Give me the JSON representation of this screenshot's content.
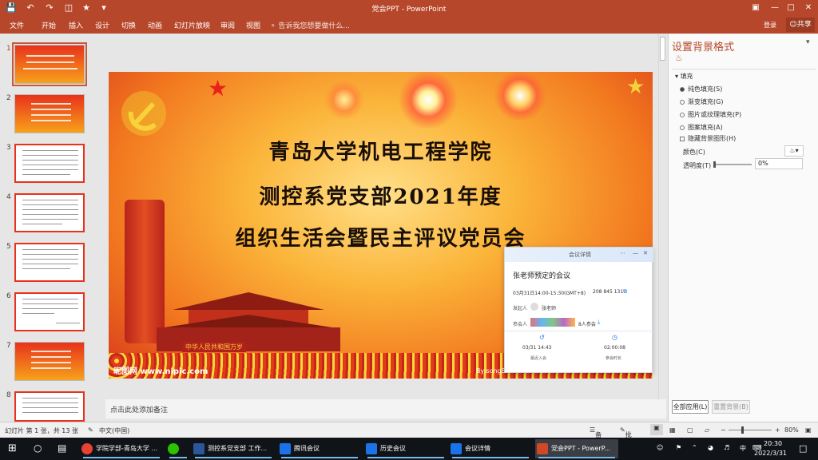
{
  "window": {
    "title": "党会PPT - PowerPoint",
    "quick_access": [
      "save-icon",
      "undo-icon",
      "redo-icon",
      "repeat-icon",
      "star-icon",
      "customize-icon"
    ]
  },
  "ribbon": {
    "tabs": [
      "文件",
      "开始",
      "插入",
      "设计",
      "切换",
      "动画",
      "幻灯片放映",
      "审阅",
      "视图"
    ],
    "tell_me": "告诉我您想要做什么...",
    "login": "登录",
    "share": "共享"
  },
  "thumbnails": {
    "numbers": [
      "1",
      "2",
      "3",
      "4",
      "5",
      "6",
      "7",
      "8"
    ]
  },
  "slide": {
    "line1": "青岛大学机电工程学院",
    "line2": "测控系党支部2021年度",
    "line3": "组织生活会暨民主评议党员会",
    "watermark_left": "昵图网 www.nipic.com",
    "watermark_right": "By:song52110 No:20120621125055063000",
    "banner_text": "中华人民共和国万岁"
  },
  "notes_placeholder": "点击此处添加备注",
  "meeting": {
    "header": "会议详情",
    "title": "张老师预定的会议",
    "time": "03月31日14:00-15:30(GMT+8)",
    "meeting_id": "208 845 131",
    "host_label": "发起人",
    "host_name": "张老师",
    "attendees_label": "参会人",
    "attendees_count": "8人参会",
    "join_time": "03/31 14:43",
    "join_label": "最近入会",
    "duration": "02:00:08",
    "duration_label": "参会时长"
  },
  "format_pane": {
    "title": "设置背景格式",
    "section": "填充",
    "options": [
      "纯色填充(S)",
      "渐变填充(G)",
      "图片或纹理填充(P)",
      "图案填充(A)"
    ],
    "hide_bg": "隐藏背景图形(H)",
    "color_label": "颜色(C)",
    "transparency_label": "透明度(T)",
    "transparency_value": "0%",
    "apply_all": "全部应用(L)",
    "reset": "重置背景(B)"
  },
  "status_bar": {
    "slide_info": "幻灯片 第 1 张，共 13 张",
    "language": "中文(中国)",
    "notes": "备注",
    "comments": "批注",
    "zoom": "80%"
  },
  "taskbar": {
    "items": [
      {
        "label": "学院学部-青岛大学 ...",
        "color": "#e94235"
      },
      {
        "label": "",
        "color": "#2dc100"
      },
      {
        "label": "测控系党支部 工作...",
        "color": "#2b579a"
      },
      {
        "label": "腾讯会议",
        "color": "#1a73e8"
      },
      {
        "label": "历史会议",
        "color": "#1a73e8"
      },
      {
        "label": "会议详情",
        "color": "#1a73e8"
      },
      {
        "label": "党会PPT - PowerP...",
        "color": "#d24726"
      }
    ],
    "time": "20:30",
    "date": "2022/3/31",
    "ime": "中"
  }
}
